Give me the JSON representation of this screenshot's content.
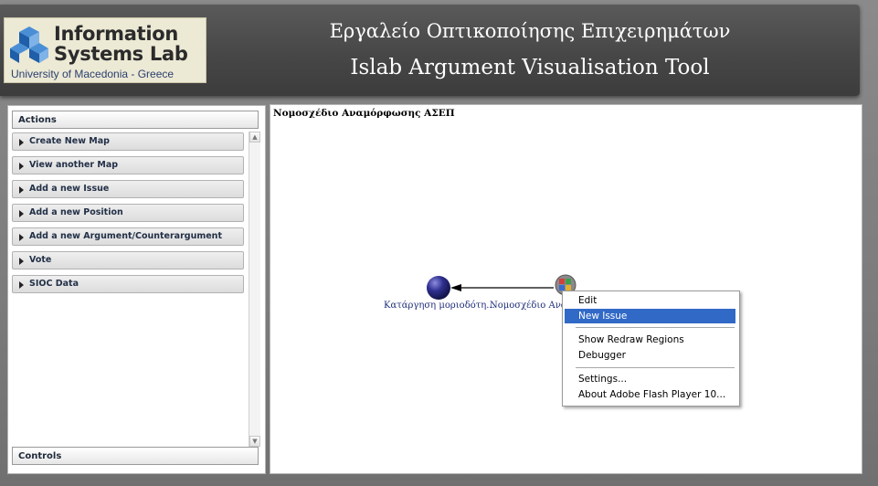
{
  "header": {
    "logo": {
      "line1": "Information",
      "line2": "Systems Lab",
      "subtitle": "University of Macedonia - Greece"
    },
    "title_greek": "Εργαλείο Οπτικοποίησης Επιχειρημάτων",
    "title_english": "Islab Argument Visualisation Tool"
  },
  "left_panel": {
    "actions_label": "Actions",
    "controls_label": "Controls",
    "actions": [
      {
        "label": "Create New Map"
      },
      {
        "label": "View another Map"
      },
      {
        "label": "Add a new Issue"
      },
      {
        "label": "Add a new Position"
      },
      {
        "label": "Add a new Argument/Counterargument"
      },
      {
        "label": "Vote"
      },
      {
        "label": "SIOC Data"
      }
    ]
  },
  "map": {
    "title": "Νομοσχέδιο Αναμόρφωσης ΑΣΕΠ",
    "nodes": [
      {
        "label": "Κατάργηση  μοριοδότη..."
      },
      {
        "label": "Νομοσχέδιο Ανα"
      }
    ]
  },
  "context_menu": {
    "items": [
      {
        "label": "Edit",
        "selected": false
      },
      {
        "label": "New Issue",
        "selected": true
      },
      {
        "label": "Show Redraw Regions",
        "selected": false
      },
      {
        "label": "Debugger",
        "selected": false
      },
      {
        "label": "Settings...",
        "selected": false
      },
      {
        "label": "About Adobe Flash Player 10...",
        "selected": false
      }
    ]
  },
  "colors": {
    "menu_highlight": "#3169c6",
    "node_issue": "#25256e",
    "header_bg": "#474747"
  }
}
